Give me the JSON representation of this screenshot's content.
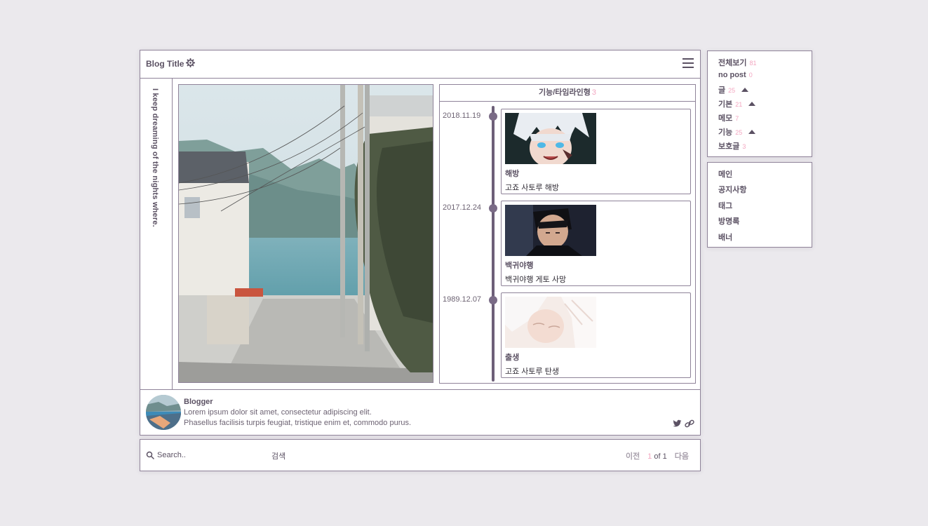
{
  "header": {
    "title": "Blog Title",
    "gear_icon": "gear-icon",
    "menu_icon": "hamburger-menu-icon"
  },
  "tagline": "I keep dreaming of the nights where.",
  "timeline": {
    "title": "기능/타임라인형",
    "count": "3",
    "items": [
      {
        "date": "2018.11.19",
        "title": "해방",
        "desc": "고죠 사토루 해방"
      },
      {
        "date": "2017.12.24",
        "title": "백귀야행",
        "desc": "백귀야행 게토 사망"
      },
      {
        "date": "1989.12.07",
        "title": "출생",
        "desc": "고죠 사토루 탄생"
      }
    ]
  },
  "profile": {
    "name": "Blogger",
    "bio_line1": "Lorem ipsum dolor sit amet, consectetur adipiscing elit.",
    "bio_line2": "Phasellus facilisis turpis feugiat, tristique enim et, commodo purus.",
    "icons": [
      "twitter-icon",
      "link-icon"
    ]
  },
  "search": {
    "placeholder": "Search..",
    "button_label": "검색",
    "pager": {
      "prev": "이전",
      "current": "1",
      "of_label": "of 1",
      "next": "다음"
    }
  },
  "categories": [
    {
      "label": "전체보기",
      "count": "81",
      "arrow": false
    },
    {
      "label": "no post",
      "count": "0",
      "arrow": false
    },
    {
      "label": "글",
      "count": "25",
      "arrow": true
    },
    {
      "label": "기본",
      "count": "21",
      "arrow": true
    },
    {
      "label": "메모",
      "count": "7",
      "arrow": false
    },
    {
      "label": "기능",
      "count": "25",
      "arrow": true
    },
    {
      "label": "보호글",
      "count": "3",
      "arrow": false
    }
  ],
  "menu": [
    "메인",
    "공지사항",
    "태그",
    "방명록",
    "배너"
  ],
  "colors": {
    "accent": "#f3a6c0",
    "text": "#5b5163",
    "border": "#8f8399",
    "background": "#ebe9ed",
    "timeline": "#6d5f78"
  }
}
